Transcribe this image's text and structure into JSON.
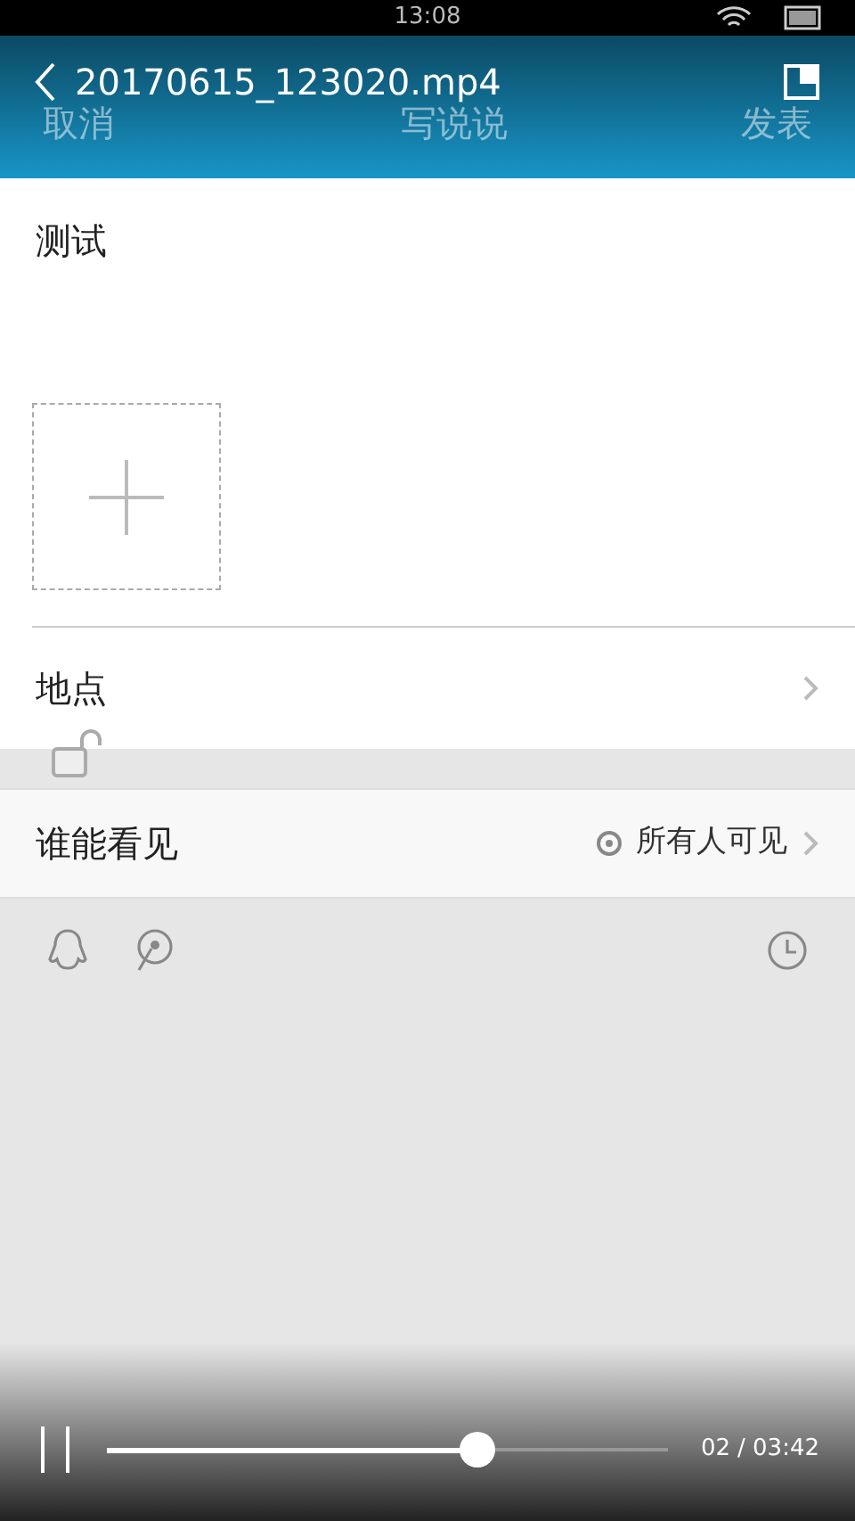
{
  "status_bar": {
    "time": "13:08"
  },
  "video_overlay": {
    "title": "20170615_123020.mp4",
    "elapsed": "02",
    "total": "/ 03:42",
    "level": 0.66,
    "playing": true
  },
  "header": {
    "cancel": "取消",
    "title": "写说说",
    "publish": "发表"
  },
  "post": {
    "text": "测试"
  },
  "rows": [
    {
      "label": "地点",
      "value": ""
    },
    {
      "label": "谁能看见",
      "value": "所有人可见"
    }
  ]
}
